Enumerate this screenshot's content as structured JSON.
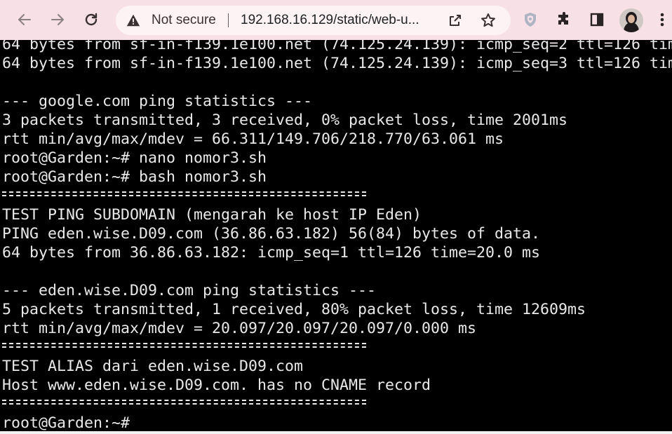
{
  "browser": {
    "back_icon": "arrow-left-icon",
    "forward_icon": "arrow-right-icon",
    "reload_icon": "reload-icon",
    "security_label": "Not secure",
    "url": "192.168.16.129/static/web-u...",
    "toolbar_color": "#f8e1e6"
  },
  "terminal": {
    "lines": [
      "64 bytes from sf-in-f139.1e100.net (74.125.24.139): icmp_seq=2 ttl=126 tim",
      "64 bytes from sf-in-f139.1e100.net (74.125.24.139): icmp_seq=3 ttl=126 tim",
      "",
      "--- google.com ping statistics ---",
      "3 packets transmitted, 3 received, 0% packet loss, time 2001ms",
      "rtt min/avg/max/mdev = 66.311/149.706/218.770/63.061 ms",
      "root@Garden:~# nano nomor3.sh",
      "root@Garden:~# bash nomor3.sh",
      "",
      "TEST PING SUBDOMAIN (mengarah ke host IP Eden)",
      "PING eden.wise.D09.com (36.86.63.182) 56(84) bytes of data.",
      "64 bytes from 36.86.63.182: icmp_seq=1 ttl=126 time=20.0 ms",
      "",
      "--- eden.wise.D09.com ping statistics ---",
      "5 packets transmitted, 1 received, 80% packet loss, time 12609ms",
      "rtt min/avg/max/mdev = 20.097/20.097/20.097/0.000 ms",
      "",
      "TEST ALIAS dari eden.wise.D09.com",
      "Host www.eden.wise.D09.com. has no CNAME record",
      "",
      "root@Garden:~#"
    ],
    "background": "#000000",
    "foreground": "#e9e9e9"
  }
}
